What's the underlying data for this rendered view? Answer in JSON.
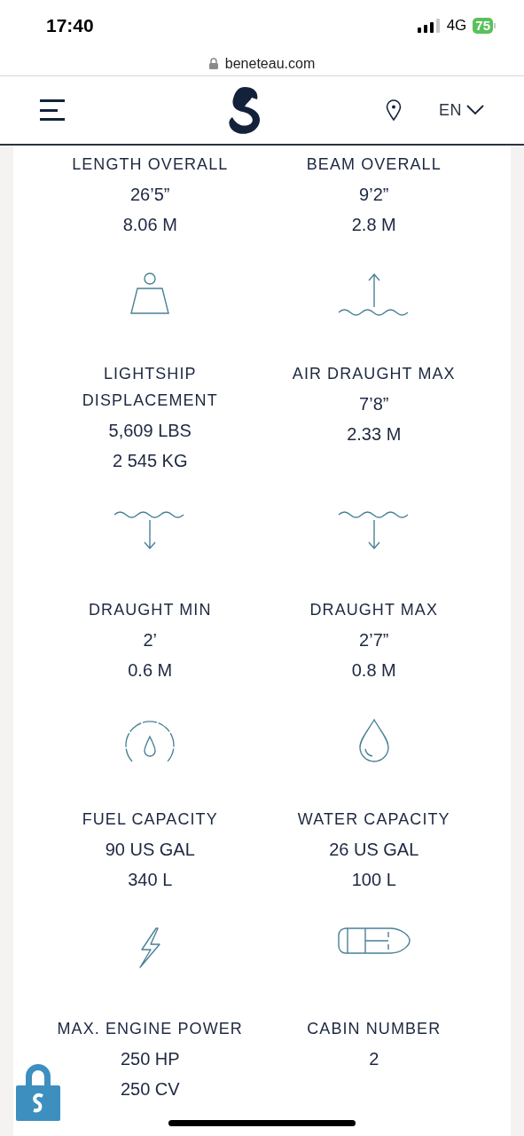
{
  "status_bar": {
    "time": "17:40",
    "network": "4G",
    "battery": "75"
  },
  "browser": {
    "url": "beneteau.com"
  },
  "header": {
    "language": "EN"
  },
  "specs": [
    {
      "label_lines": [
        "LENGTH OVERALL"
      ],
      "values": [
        "26’5”",
        "8.06 M"
      ]
    },
    {
      "label_lines": [
        "BEAM OVERALL"
      ],
      "values": [
        "9’2”",
        "2.8 M"
      ]
    },
    {
      "kind": "weight",
      "label_lines": [
        "LIGHTSHIP",
        "DISPLACEMENT"
      ],
      "values": [
        "5,609 LBS",
        "2 545 KG"
      ]
    },
    {
      "kind": "air-draught",
      "label_lines": [
        "AIR DRAUGHT MAX"
      ],
      "values": [
        "7’8”",
        "2.33 M"
      ]
    },
    {
      "kind": "draught",
      "label_lines": [
        "DRAUGHT MIN"
      ],
      "values": [
        "2’",
        "0.6 M"
      ]
    },
    {
      "kind": "draught",
      "label_lines": [
        "DRAUGHT MAX"
      ],
      "values": [
        "2’7”",
        "0.8 M"
      ]
    },
    {
      "kind": "fuel",
      "label_lines": [
        "FUEL CAPACITY"
      ],
      "values": [
        "90 US GAL",
        "340 L"
      ]
    },
    {
      "kind": "water",
      "label_lines": [
        "WATER CAPACITY"
      ],
      "values": [
        "26 US GAL",
        "100 L"
      ]
    },
    {
      "kind": "engine",
      "label_lines": [
        "MAX. ENGINE POWER"
      ],
      "values": [
        "250 HP",
        "250 CV"
      ]
    },
    {
      "kind": "cabin",
      "label_lines": [
        "CABIN NUMBER"
      ],
      "values": [
        "2"
      ]
    }
  ]
}
